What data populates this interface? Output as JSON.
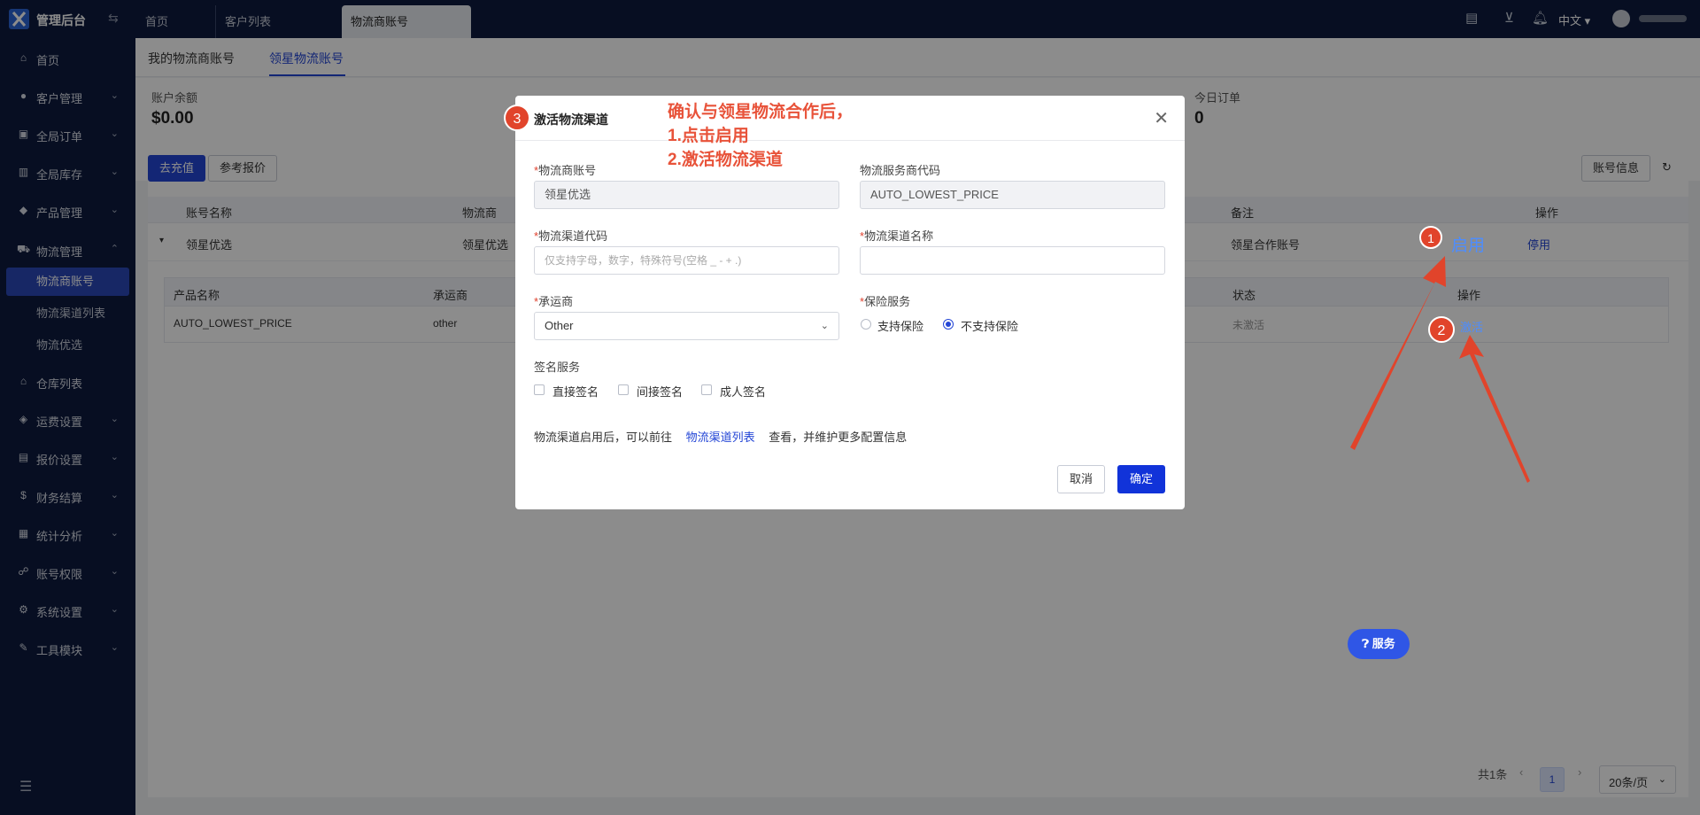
{
  "app": {
    "title": "管理后台"
  },
  "tabs": [
    "首页",
    "客户列表",
    "物流商账号"
  ],
  "topbar": {
    "lang": "中文"
  },
  "sidebar": {
    "items": [
      {
        "label": "首页",
        "icon": "home-icon"
      },
      {
        "label": "客户管理",
        "icon": "users-icon"
      },
      {
        "label": "全局订单",
        "icon": "orders-icon"
      },
      {
        "label": "全局库存",
        "icon": "inventory-icon"
      },
      {
        "label": "产品管理",
        "icon": "product-icon"
      },
      {
        "label": "物流管理",
        "icon": "truck-icon"
      },
      {
        "label": "仓库列表",
        "icon": "warehouse-icon"
      },
      {
        "label": "运费设置",
        "icon": "freight-icon"
      },
      {
        "label": "报价设置",
        "icon": "quote-icon"
      },
      {
        "label": "财务结算",
        "icon": "finance-icon"
      },
      {
        "label": "统计分析",
        "icon": "stats-icon"
      },
      {
        "label": "账号权限",
        "icon": "permission-icon"
      },
      {
        "label": "系统设置",
        "icon": "settings-icon"
      },
      {
        "label": "工具模块",
        "icon": "tools-icon"
      }
    ],
    "subitems": [
      "物流商账号",
      "物流渠道列表",
      "物流优选"
    ]
  },
  "page": {
    "subtabs": [
      "我的物流商账号",
      "领星物流账号"
    ],
    "stats": [
      {
        "label": "账户余额",
        "value": "$0.00"
      },
      {
        "label": "今日订单",
        "value": "0"
      }
    ],
    "buttons": {
      "recharge": "去充值",
      "reference_price": "参考报价",
      "account_info": "账号信息"
    },
    "table": {
      "headers": [
        "账号名称",
        "物流商",
        "备注",
        "操作"
      ],
      "row": {
        "name": "领星优选",
        "carrier": "领星优选",
        "remark": "领星合作账号",
        "enable": "启用",
        "disable": "停用"
      }
    },
    "subtable": {
      "headers": [
        "产品名称",
        "承运商",
        "状态",
        "操作"
      ],
      "row": {
        "product": "AUTO_LOWEST_PRICE",
        "carrier": "other",
        "status": "未激活",
        "action": "激活"
      }
    },
    "pager": {
      "total": "共1条",
      "current": "1",
      "page_size": "20条/页"
    }
  },
  "service_button": "服务",
  "annotation": {
    "lines": [
      "确认与领星物流合作后，",
      "1.点击启用",
      "2.激活物流渠道"
    ],
    "badges": [
      "1",
      "2",
      "3"
    ]
  },
  "modal": {
    "title": "激活物流渠道",
    "fields": {
      "account_label": "物流商账号",
      "account_value": "领星优选",
      "provider_code_label": "物流服务商代码",
      "provider_code_value": "AUTO_LOWEST_PRICE",
      "channel_code_label": "物流渠道代码",
      "channel_code_placeholder": "仅支持字母，数字，特殊符号(空格 _ - + .)",
      "channel_name_label": "物流渠道名称",
      "carrier_label": "承运商",
      "carrier_value": "Other",
      "insurance_label": "保险服务",
      "insurance_yes": "支持保险",
      "insurance_no": "不支持保险",
      "signature_label": "签名服务",
      "signature_direct": "直接签名",
      "signature_indirect": "间接签名",
      "signature_adult": "成人签名"
    },
    "hint_before": "物流渠道启用后，可以前往",
    "hint_link": "物流渠道列表",
    "hint_after": "查看，并维护更多配置信息",
    "cancel": "取消",
    "ok": "确定"
  },
  "colors": {
    "brand": "#0d1b3e",
    "primary": "#2446d6",
    "annotation": "#e1442b"
  }
}
